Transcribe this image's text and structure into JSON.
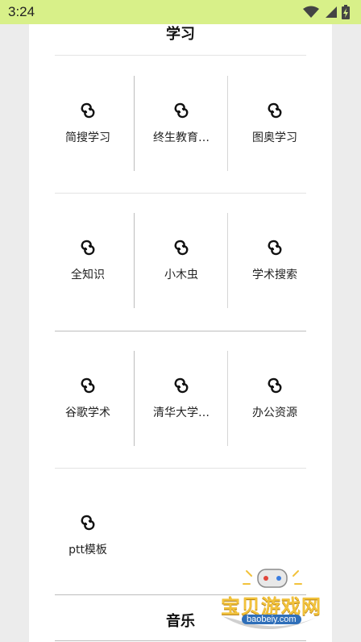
{
  "status_bar": {
    "time": "3:24"
  },
  "sections": [
    {
      "title": "学习",
      "items": [
        {
          "label": "简搜学习"
        },
        {
          "label": "终生教育…"
        },
        {
          "label": "图奥学习"
        },
        {
          "label": "全知识"
        },
        {
          "label": "小木虫"
        },
        {
          "label": "学术搜索"
        },
        {
          "label": "谷歌学术"
        },
        {
          "label": "清华大学…"
        },
        {
          "label": "办公资源"
        },
        {
          "label": "ptt模板"
        }
      ]
    },
    {
      "title": "音乐",
      "items": []
    }
  ],
  "watermark": {
    "name": "宝贝游戏网",
    "url": "baobeiy.com"
  },
  "colors": {
    "status_bar_bg": "#d8f089",
    "page_bg": "#ececec",
    "card_bg": "#ffffff",
    "watermark_text": "#f2c23b",
    "watermark_url_bg": "#2f6fb9"
  },
  "icons": {
    "item_icon": "link-chain-icon",
    "status": [
      "wifi-icon",
      "cell-signal-icon",
      "battery-charging-icon"
    ]
  }
}
